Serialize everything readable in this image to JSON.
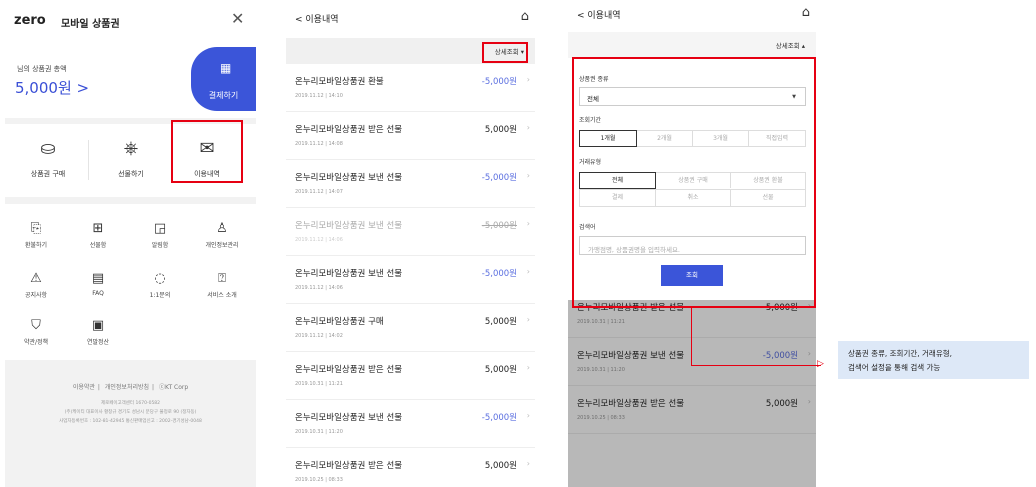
{
  "panel1": {
    "logo": "zero",
    "logo_sub": "모바일 상품권",
    "close_icon": "close-icon",
    "balance_label": "님의 상품권 총액",
    "balance_value": "5,000원 >",
    "pay_label": "결제하기",
    "quick_items": [
      {
        "label": "상품권 구매",
        "icon": "basket-icon"
      },
      {
        "label": "선물하기",
        "icon": "gift-hand-icon"
      },
      {
        "label": "이용내역",
        "icon": "envelope-icon"
      }
    ],
    "grid_items": [
      {
        "label": "환불하기",
        "icon": "refund-icon"
      },
      {
        "label": "선물함",
        "icon": "gift-box-icon"
      },
      {
        "label": "알림함",
        "icon": "bell-icon"
      },
      {
        "label": "개인정보관리",
        "icon": "user-settings-icon"
      },
      {
        "label": "공지사항",
        "icon": "notice-icon"
      },
      {
        "label": "FAQ",
        "icon": "faq-icon"
      },
      {
        "label": "1:1문의",
        "icon": "chat-icon"
      },
      {
        "label": "서비스 소개",
        "icon": "question-icon"
      },
      {
        "label": "약관/정책",
        "icon": "shield-icon"
      },
      {
        "label": "연말정산",
        "icon": "calculator-icon"
      }
    ],
    "footer_links": [
      "이용약관",
      "개인정보처리방침",
      "ⓒKT Corp"
    ],
    "footer_info": [
      "제로페이고객센터 1670-0582",
      "(주)케이티 대표이사 황창규 경기도 성남시 분당구 불정로 90 (정자동)",
      "사업자등록번호 : 102-81-42945 통신판매업신고 : 2002-경기성남-0048"
    ]
  },
  "panel2": {
    "back_label": "< 이용내역",
    "home_icon": "home-icon",
    "filter_label": "상세조회 ▾",
    "rows": [
      {
        "title": "온누리모바일상품권 환불",
        "date": "2019.11.12 | 14:10",
        "amount": "-5,000원",
        "neg": true,
        "cancel": false
      },
      {
        "title": "온누리모바일상품권 받은 선물",
        "date": "2019.11.12 | 14:08",
        "amount": "5,000원",
        "neg": false,
        "cancel": false
      },
      {
        "title": "온누리모바일상품권 보낸 선물",
        "date": "2019.11.12 | 14:07",
        "amount": "-5,000원",
        "neg": true,
        "cancel": false
      },
      {
        "title": "온누리모바일상품권 보낸 선물",
        "date": "2019.11.12 | 14:06",
        "amount": "-5,000원",
        "neg": true,
        "cancel": true
      },
      {
        "title": "온누리모바일상품권 보낸 선물",
        "date": "2019.11.12 | 14:06",
        "amount": "-5,000원",
        "neg": true,
        "cancel": false
      },
      {
        "title": "온누리모바일상품권 구매",
        "date": "2019.11.12 | 14:02",
        "amount": "5,000원",
        "neg": false,
        "cancel": false
      },
      {
        "title": "온누리모바일상품권 받은 선물",
        "date": "2019.10.31 | 11:21",
        "amount": "5,000원",
        "neg": false,
        "cancel": false
      },
      {
        "title": "온누리모바일상품권 보낸 선물",
        "date": "2019.10.31 | 11:20",
        "amount": "-5,000원",
        "neg": true,
        "cancel": false
      },
      {
        "title": "온누리모바일상품권 받은 선물",
        "date": "2019.10.25 | 08:33",
        "amount": "5,000원",
        "neg": false,
        "cancel": false
      }
    ]
  },
  "panel3": {
    "back_label": "< 이용내역",
    "filter_label": "상세조회 ▴",
    "type_label": "상품권 종류",
    "type_value": "전체",
    "period_label": "조회기간",
    "period_options": [
      "1개월",
      "2개월",
      "3개월",
      "직접입력"
    ],
    "period_selected": 0,
    "trans_label": "거래유형",
    "trans_options": [
      "전체",
      "상품권 구매",
      "상품권 환불",
      "결제",
      "취소",
      "선물"
    ],
    "trans_selected": 0,
    "keyword_label": "검색어",
    "keyword_placeholder": "가맹점명, 상품권명을 입력하세요.",
    "submit_label": "조회",
    "rows": [
      {
        "title": "온누리모바일상품권 받은 선물",
        "date": "2019.10.31 | 11:21",
        "amount": "5,000원",
        "neg": false
      },
      {
        "title": "온누리모바일상품권 보낸 선물",
        "date": "2019.10.31 | 11:20",
        "amount": "-5,000원",
        "neg": true
      },
      {
        "title": "온누리모바일상품권 받은 선물",
        "date": "2019.10.25 | 08:33",
        "amount": "5,000원",
        "neg": false
      }
    ]
  },
  "annotation": {
    "line1": "상품권 종류, 조회기간, 거래유형,",
    "line2": "검색어 설정을 통해 검색 가능"
  },
  "colors": {
    "accent": "#3b55d9",
    "highlight": "#e60012",
    "negative": "#5b6fe0",
    "annotation_bg": "#dde8f7"
  }
}
